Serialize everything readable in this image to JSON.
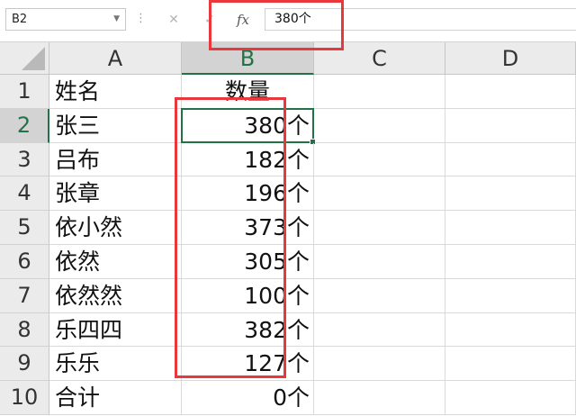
{
  "formula_bar": {
    "name_box": "B2",
    "dropdown_icon": "chevron-down-icon",
    "separator": "⋮",
    "cancel_icon": "✕",
    "enter_icon": "✓",
    "fx_label": "fx",
    "formula": "380个"
  },
  "columns": [
    "A",
    "B",
    "C",
    "D"
  ],
  "rows": [
    {
      "num": "1",
      "a": "姓名",
      "b": "数量"
    },
    {
      "num": "2",
      "a": "张三",
      "b": "380个"
    },
    {
      "num": "3",
      "a": "吕布",
      "b": "182个"
    },
    {
      "num": "4",
      "a": "张章",
      "b": "196个"
    },
    {
      "num": "5",
      "a": "依小然",
      "b": "373个"
    },
    {
      "num": "6",
      "a": "依然",
      "b": "305个"
    },
    {
      "num": "7",
      "a": "依然然",
      "b": "100个"
    },
    {
      "num": "8",
      "a": "乐四四",
      "b": "382个"
    },
    {
      "num": "9",
      "a": "乐乐",
      "b": "127个"
    },
    {
      "num": "10",
      "a": "合计",
      "b": "0个"
    }
  ],
  "selection": {
    "cell": "B2",
    "column": "B",
    "row": "2"
  },
  "colors": {
    "accent": "#217346",
    "annotation": "#e8383b"
  }
}
